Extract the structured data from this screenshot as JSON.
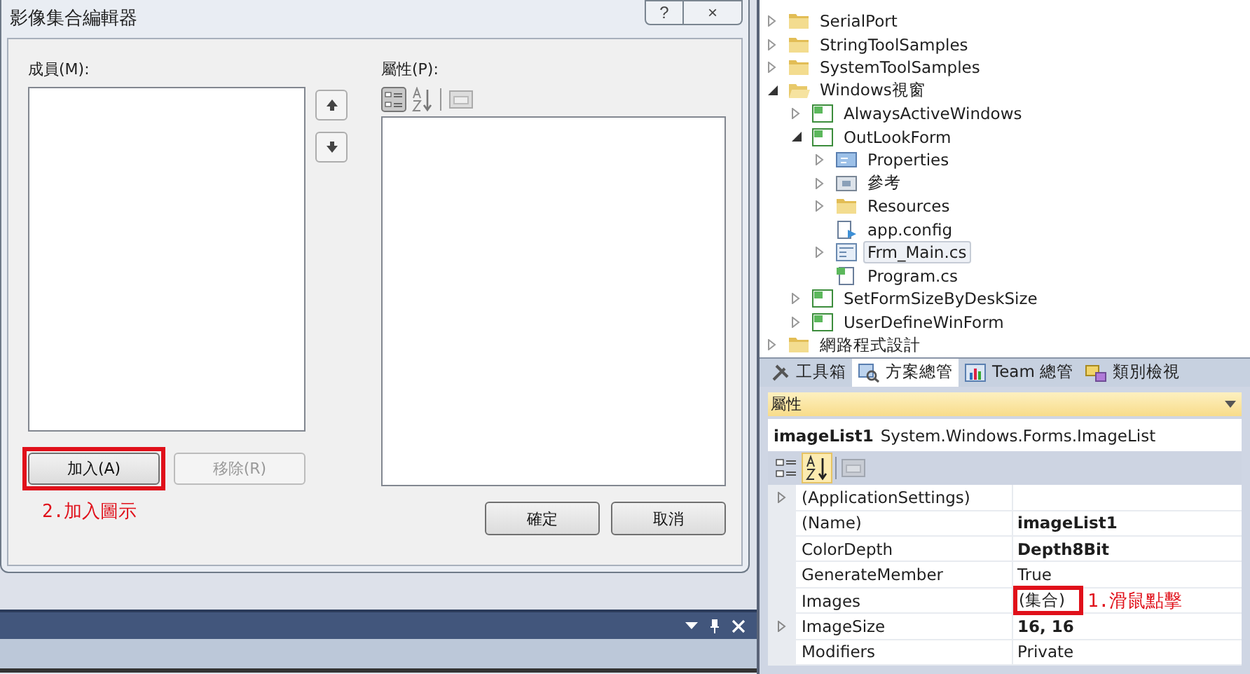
{
  "dialog": {
    "title": "影像集合編輯器",
    "help_button": "?",
    "close_button": "×",
    "members_label": "成員(M):",
    "properties_label": "屬性(P):",
    "add_button": {
      "label": "加入(A)",
      "disabled": false
    },
    "remove_button": {
      "label": "移除(R)",
      "disabled": true
    },
    "ok_button": "確定",
    "cancel_button": "取消",
    "annotation": "2.加入圖示"
  },
  "solution_tree": [
    {
      "label": "SerialPort",
      "kind": "folder",
      "expanded": false
    },
    {
      "label": "StringToolSamples",
      "kind": "folder",
      "expanded": false
    },
    {
      "label": "SystemToolSamples",
      "kind": "folder",
      "expanded": false
    },
    {
      "label": "Windows視窗",
      "kind": "folder",
      "expanded": true,
      "children": [
        {
          "label": "AlwaysActiveWindows",
          "kind": "project",
          "expanded": false
        },
        {
          "label": "OutLookForm",
          "kind": "project",
          "expanded": true,
          "children": [
            {
              "label": "Properties",
              "kind": "properties",
              "expanded": false
            },
            {
              "label": "參考",
              "kind": "references",
              "expanded": false
            },
            {
              "label": "Resources",
              "kind": "folder",
              "expanded": false
            },
            {
              "label": "app.config",
              "kind": "config",
              "selected": false
            },
            {
              "label": "Frm_Main.cs",
              "kind": "form",
              "expanded": false,
              "selected": true
            },
            {
              "label": "Program.cs",
              "kind": "code",
              "selected": false
            }
          ]
        },
        {
          "label": "SetFormSizeByDeskSize",
          "kind": "project",
          "expanded": false
        },
        {
          "label": "UserDefineWinForm",
          "kind": "project",
          "expanded": false
        }
      ]
    },
    {
      "label": "網路程式設計",
      "kind": "folder",
      "expanded": false
    }
  ],
  "tool_tabs": [
    {
      "label": "工具箱",
      "selected": false,
      "kind": "toolbox"
    },
    {
      "label": "方案總管",
      "selected": true,
      "kind": "solution"
    },
    {
      "label": "Team 總管",
      "selected": false,
      "kind": "team"
    },
    {
      "label": "類別檢視",
      "selected": false,
      "kind": "class"
    }
  ],
  "properties_panel": {
    "title": "屬性",
    "object_name": "imageList1",
    "object_type": "System.Windows.Forms.ImageList",
    "alphabetical": true,
    "rows": [
      {
        "name": "(ApplicationSettings)",
        "expandable": true
      },
      {
        "name": "(Name)",
        "value": "imageList1",
        "expandable": false,
        "modified": true
      },
      {
        "name": "ColorDepth",
        "value": "Depth8Bit",
        "expandable": false,
        "modified": true
      },
      {
        "name": "GenerateMember",
        "value": "True",
        "expandable": false,
        "modified": false
      },
      {
        "name": "Images",
        "value": "(集合)",
        "expandable": false,
        "modified": false,
        "highlighted": true
      },
      {
        "name": "ImageSize",
        "value": "16, 16",
        "expandable": true,
        "modified": true
      },
      {
        "name": "Modifiers",
        "value": "Private",
        "expandable": false,
        "modified": false
      }
    ],
    "annotation": "1.滑鼠點擊"
  }
}
